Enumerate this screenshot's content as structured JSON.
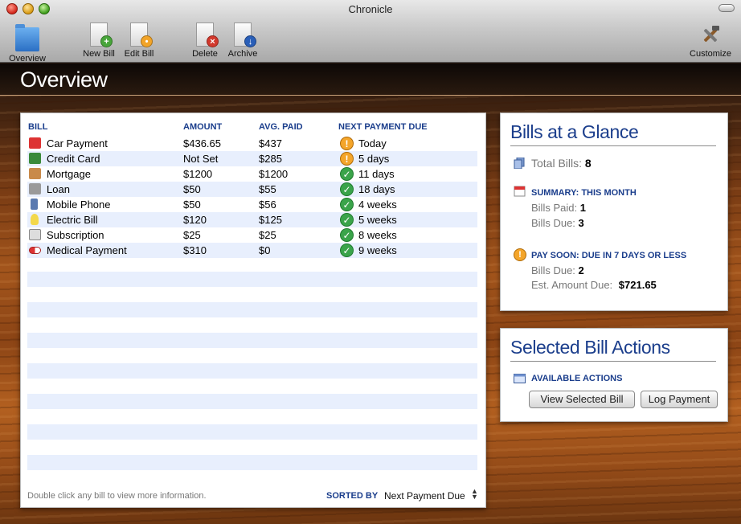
{
  "window": {
    "title": "Chronicle"
  },
  "toolbar": {
    "overview": "Overview",
    "new_bill": "New Bill",
    "edit_bill": "Edit Bill",
    "delete": "Delete",
    "archive": "Archive",
    "customize": "Customize"
  },
  "page": {
    "title": "Overview"
  },
  "bills": {
    "headers": {
      "bill": "BILL",
      "amount": "AMOUNT",
      "avg_paid": "AVG. PAID",
      "next_due": "NEXT PAYMENT DUE"
    },
    "rows": [
      {
        "name": "Car Payment",
        "amount": "$436.65",
        "avg": "$437",
        "due": "Today",
        "status": "warning",
        "icon": "car-icon"
      },
      {
        "name": "Credit Card",
        "amount": "Not Set",
        "avg": "$285",
        "due": "5 days",
        "status": "warning",
        "icon": "credit-card-icon"
      },
      {
        "name": "Mortgage",
        "amount": "$1200",
        "avg": "$1200",
        "due": "11 days",
        "status": "ok",
        "icon": "house-icon"
      },
      {
        "name": "Loan",
        "amount": "$50",
        "avg": "$55",
        "due": "18 days",
        "status": "ok",
        "icon": "bank-icon"
      },
      {
        "name": "Mobile Phone",
        "amount": "$50",
        "avg": "$56",
        "due": "4 weeks",
        "status": "ok",
        "icon": "phone-icon"
      },
      {
        "name": "Electric Bill",
        "amount": "$120",
        "avg": "$125",
        "due": "5 weeks",
        "status": "ok",
        "icon": "lightbulb-icon"
      },
      {
        "name": "Subscription",
        "amount": "$25",
        "avg": "$25",
        "due": "8 weeks",
        "status": "ok",
        "icon": "newspaper-icon"
      },
      {
        "name": "Medical Payment",
        "amount": "$310",
        "avg": "$0",
        "due": "9 weeks",
        "status": "ok",
        "icon": "pill-icon"
      }
    ],
    "footer_hint": "Double click any bill to view more information.",
    "sorted_by_label": "SORTED BY",
    "sorted_by_value": "Next Payment Due"
  },
  "glance": {
    "title": "Bills at a Glance",
    "total_label": "Total Bills:",
    "total_value": "8",
    "summary_title": "SUMMARY: THIS MONTH",
    "paid_label": "Bills Paid:",
    "paid_value": "1",
    "due_label": "Bills Due:",
    "due_value": "3",
    "soon_title": "PAY SOON: DUE IN 7 DAYS OR LESS",
    "soon_due_label": "Bills Due:",
    "soon_due_value": "2",
    "est_label": "Est. Amount Due:",
    "est_value": "$721.65"
  },
  "actions": {
    "title": "Selected Bill Actions",
    "section_title": "AVAILABLE ACTIONS",
    "view_button": "View Selected Bill",
    "log_button": "Log Payment"
  },
  "colors": {
    "accent": "#1b3e8c",
    "row_alt": "#e8effd",
    "ok": "#3aa44a",
    "warning": "#f4a52a"
  }
}
